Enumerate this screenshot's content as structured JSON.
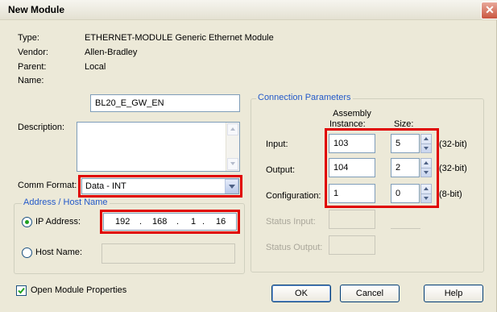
{
  "window": {
    "title": "New Module",
    "close_glyph": "✕"
  },
  "info": [
    {
      "label": "Type:",
      "value": "ETHERNET-MODULE Generic Ethernet Module"
    },
    {
      "label": "Vendor:",
      "value": "Allen-Bradley"
    },
    {
      "label": "Parent:",
      "value": "Local"
    }
  ],
  "name": {
    "label": "Name:",
    "value": "BL20_E_GW_EN"
  },
  "description": {
    "label": "Description:",
    "value": ""
  },
  "comm_format": {
    "label": "Comm Format:",
    "value": "Data - INT"
  },
  "address": {
    "legend": "Address / Host Name",
    "ip_label": "IP Address:",
    "ip_octets": [
      "192",
      "168",
      "1",
      "16"
    ],
    "host_label": "Host Name:",
    "host_value": "",
    "selected": "ip"
  },
  "connection": {
    "legend": "Connection Parameters",
    "col_assembly_line1": "Assembly",
    "col_assembly_line2": "Instance:",
    "col_size": "Size:",
    "rows": [
      {
        "label": "Input:",
        "instance": "103",
        "size": "5",
        "unit": "(32-bit)"
      },
      {
        "label": "Output:",
        "instance": "104",
        "size": "2",
        "unit": "(32-bit)"
      },
      {
        "label": "Configuration:",
        "instance": "1",
        "size": "0",
        "unit": "(8-bit)"
      }
    ],
    "status_input_label": "Status Input:",
    "status_output_label": "Status Output:"
  },
  "footer": {
    "open_props_label": "Open Module Properties",
    "open_props_checked": true,
    "ok": "OK",
    "cancel": "Cancel",
    "help": "Help"
  },
  "icons": {
    "check": "check-icon",
    "dropdown": "chevron-down-icon",
    "spin_up": "arrow-up-icon",
    "spin_down": "arrow-down-icon"
  },
  "colors": {
    "highlight_box": "#e00000",
    "group_legend": "#2359c9",
    "dialog_bg": "#ece9d8"
  }
}
